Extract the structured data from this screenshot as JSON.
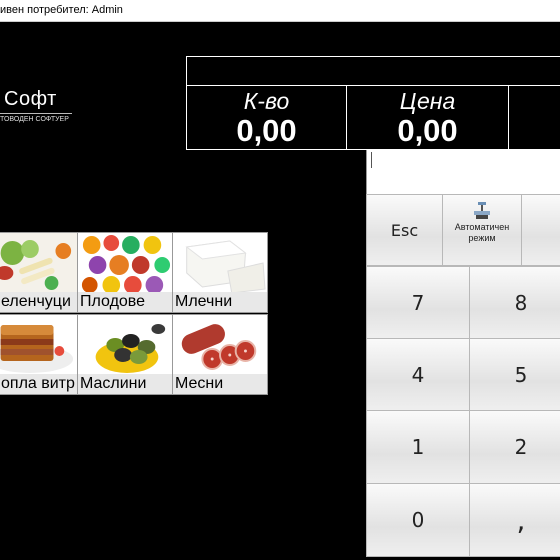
{
  "window": {
    "title": "ивен потребител: Admin"
  },
  "logo": {
    "brand": "Софт",
    "tagline": "ТОВОДЕН СОФТУЕР"
  },
  "display": {
    "qty_label": "К-во",
    "qty_value": "0,00",
    "price_label": "Цена",
    "price_value": "0,00"
  },
  "keypad": {
    "esc": "Esc",
    "auto_mode": "Автоматичен режим",
    "k7": "7",
    "k8": "8",
    "k4": "4",
    "k5": "5",
    "k1": "1",
    "k2": "2",
    "k0": "0",
    "comma": ","
  },
  "categories": [
    {
      "label": "еленчуци",
      "icon": "vegetables-image"
    },
    {
      "label": "Плодове",
      "icon": "fruits-image"
    },
    {
      "label": "Млечни",
      "icon": "dairy-image"
    },
    {
      "label": "опла витр",
      "icon": "hot-dish-image"
    },
    {
      "label": "Маслини",
      "icon": "olives-image"
    },
    {
      "label": "Месни",
      "icon": "salami-image"
    }
  ],
  "colors": {
    "background": "#000000",
    "key_face": "#ececec",
    "caption_bg": "#e8e8e8"
  }
}
